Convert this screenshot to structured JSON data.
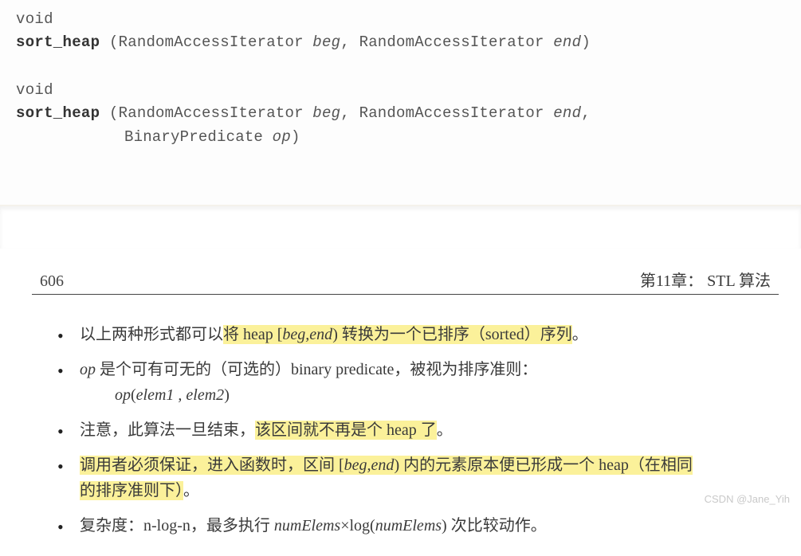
{
  "signatures": {
    "sig1": {
      "ret": "void",
      "name": "sort_heap",
      "open_type1": "(RandomAccessIterator ",
      "param1": "beg",
      "sep1": ", RandomAccessIterator ",
      "param2": "end",
      "close": ")"
    },
    "sig2": {
      "ret": "void",
      "name": "sort_heap",
      "open_type1": "(RandomAccessIterator ",
      "param1": "beg",
      "sep1": ", RandomAccessIterator ",
      "param2": "end",
      "sep2": ",",
      "line2_type": "BinaryPredicate ",
      "param3": "op",
      "close": ")"
    }
  },
  "page": {
    "number": "606",
    "chapter": "第11章：  STL 算法"
  },
  "bullets": {
    "b1_a": "以上两种形式都可以",
    "b1_hl_a": "将 heap [",
    "b1_ital_a": "beg,end",
    "b1_hl_b": ") 转换为一个已排序（sorted）序列",
    "b1_end": "。",
    "b2_a": "",
    "b2_ital_op": "op",
    "b2_b": " 是个可有可无的（可选的）binary predicate，被视为排序准则：",
    "b2_sub_ital_a": "op",
    "b2_sub_b": "(",
    "b2_sub_ital_c": "elem1 , elem2",
    "b2_sub_d": ")",
    "b3_a": "注意，此算法一旦结束，",
    "b3_hl_a": "该区间就不再是个 heap 了",
    "b3_end": "。",
    "b4_hl_a": "调用者必须保证，进入函数时，区间 [",
    "b4_ital_a": "beg,end",
    "b4_hl_b": ") 内的元素原本便已形成一个 heap（在相同",
    "b4_hl_c": "的排序准则下）",
    "b4_end": "。",
    "b5_a": "复杂度：n-log-n，最多执行 ",
    "b5_ital_a": "numElems",
    "b5_b": "×log(",
    "b5_ital_b": "numElems",
    "b5_c": ") 次比较动作。"
  },
  "watermark": "CSDN @Jane_Yih"
}
